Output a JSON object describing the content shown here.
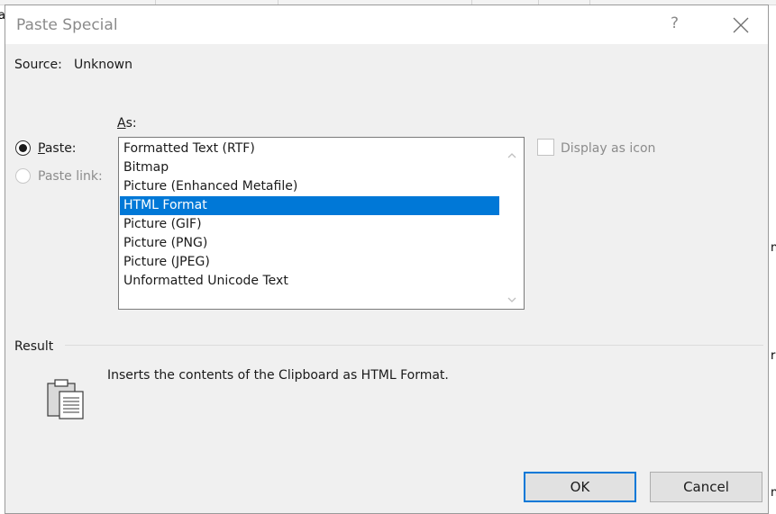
{
  "background_fragments": [
    "a",
    "n",
    "r",
    "n"
  ],
  "dialog": {
    "title": "Paste Special",
    "help_label": "?",
    "close_icon": "close-icon"
  },
  "source": {
    "label": "Source:",
    "value": "Unknown"
  },
  "as_label_prefix": "A",
  "as_label_rest": "s:",
  "paste_options": {
    "paste_prefix": "P",
    "paste_rest": "aste:",
    "paste_link": "Paste link:",
    "selected": "Paste"
  },
  "formats": {
    "items": [
      "Formatted Text (RTF)",
      "Bitmap",
      "Picture (Enhanced Metafile)",
      "HTML Format",
      "Picture (GIF)",
      "Picture (PNG)",
      "Picture (JPEG)",
      "Unformatted Unicode Text"
    ],
    "selected_index": 3
  },
  "display_as_icon": {
    "label": "Display as icon",
    "checked": false
  },
  "result": {
    "heading": "Result",
    "description": "Inserts the contents of the Clipboard as HTML Format.",
    "icon": "clipboard-icon"
  },
  "buttons": {
    "ok": "OK",
    "cancel": "Cancel"
  },
  "colors": {
    "selection": "#0078d7",
    "dialog_bg": "#f0f0f0"
  }
}
